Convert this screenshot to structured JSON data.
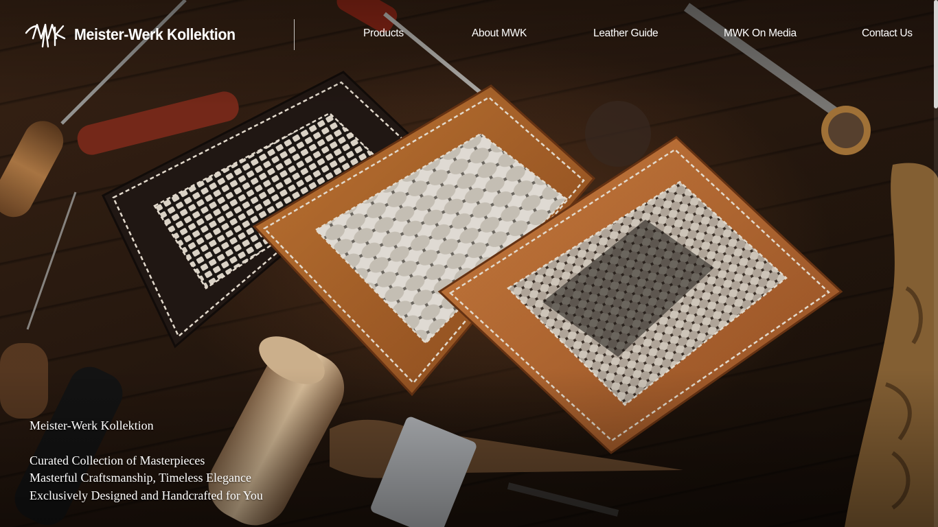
{
  "brand": {
    "logo_alt": "MWK logo",
    "name": "Meister-Werk Kollektion"
  },
  "nav": {
    "items": [
      {
        "label": "Products"
      },
      {
        "label": "About MWK"
      },
      {
        "label": "Leather Guide"
      },
      {
        "label": "MWK On Media"
      },
      {
        "label": "Contact Us"
      }
    ]
  },
  "hero": {
    "title": "Meister-Werk Kollektion",
    "lines": [
      "Curated Collection of Masterpieces",
      "Masterful Craftsmanship, Timeless Elegance",
      "Exclusively Designed and Handcrafted for You"
    ],
    "image_subject": "three leather card holders with python-skin inlays on a workbench with leather tools"
  },
  "colors": {
    "wood_dark": "#1e130b",
    "leather_tan": "#b0652a",
    "leather_black": "#221814",
    "stitch": "#efe6d8",
    "text": "#ffffff"
  }
}
